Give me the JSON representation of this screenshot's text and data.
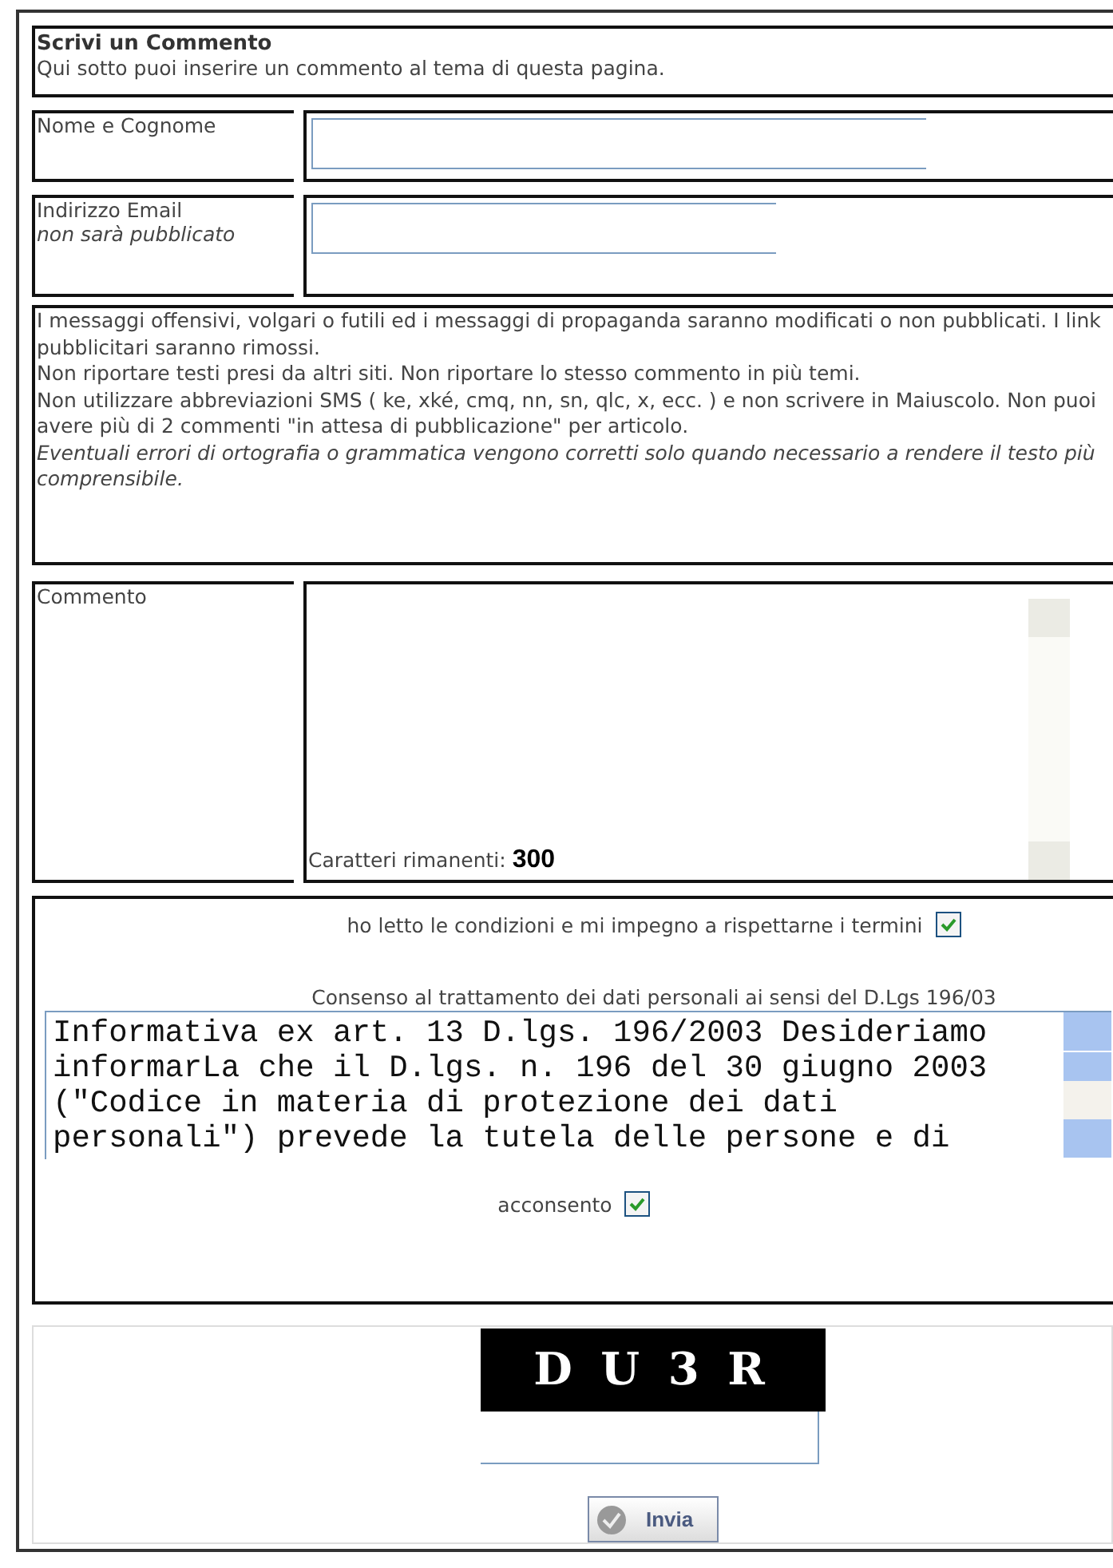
{
  "header": {
    "title": "Scrivi un Commento",
    "subtitle": "Qui sotto puoi inserire un commento al tema di questa pagina."
  },
  "fields": [
    {
      "kind": "text",
      "label": "Nome e Cognome"
    },
    {
      "kind": "email",
      "label": "Indirizzo Email",
      "note": "non sarà pubblicato"
    }
  ],
  "rules": [
    "I messaggi offensivi, volgari o futili ed i messaggi di propaganda saranno modificati o non pubblicati. I link pubblicitari saranno rimossi.",
    "Non riportare testi presi da altri siti. Non riportare lo stesso commento in più temi.",
    "Non utilizzare abbreviazioni SMS ( ke, xké, cmq, nn, sn, qlc, x, ecc. ) e non scrivere in Maiuscolo. Non puoi avere più di 2 commenti \"in attesa di pubblicazione\" per articolo."
  ],
  "rules_note": "Eventuali errori di ortografia o grammatica vengono corretti solo quando necessario a rendere il testo più comprensibile.",
  "comment": {
    "label": "Commento",
    "remaining_label": "Caratteri rimanenti:",
    "remaining": "300"
  },
  "terms": {
    "label": "ho letto le condizioni e mi impegno a rispettarne i termini",
    "checked": true
  },
  "privacy": {
    "title": "Consenso al trattamento dei dati personali ai sensi del D.Lgs 196/03",
    "text": "Informativa ex art. 13 D.lgs. 196/2003 Desideriamo informarLa che il D.lgs. n. 196 del 30 giugno 2003 (\"Codice in materia di protezione dei dati personali\") prevede la tutela delle persone e di",
    "consent_label": "acconsento",
    "consent_checked": true
  },
  "captcha": {
    "code": "D U 3 R"
  },
  "submit": "Invia"
}
